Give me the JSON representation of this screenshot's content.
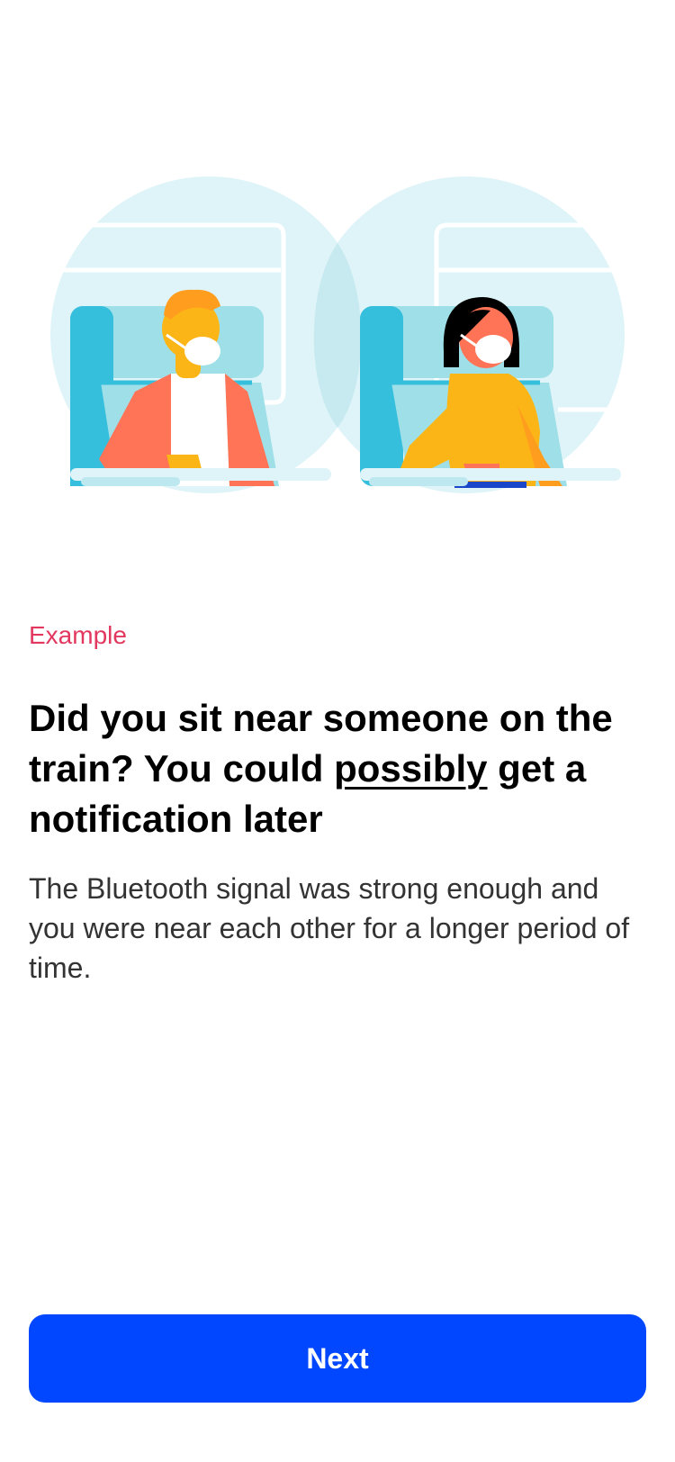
{
  "illustration": {
    "icon": "train-passengers-illustration"
  },
  "content": {
    "eyebrow": "Example",
    "title_part1": "Did you sit near someone on the train? You could ",
    "title_emphasis": "possibly",
    "title_part2": " get a notification later",
    "body": "The Bluetooth signal was strong enough and you were near each other for a longer period of time."
  },
  "actions": {
    "next_label": "Next"
  },
  "colors": {
    "accent": "#0147ff",
    "eyebrow": "#e2385f"
  }
}
